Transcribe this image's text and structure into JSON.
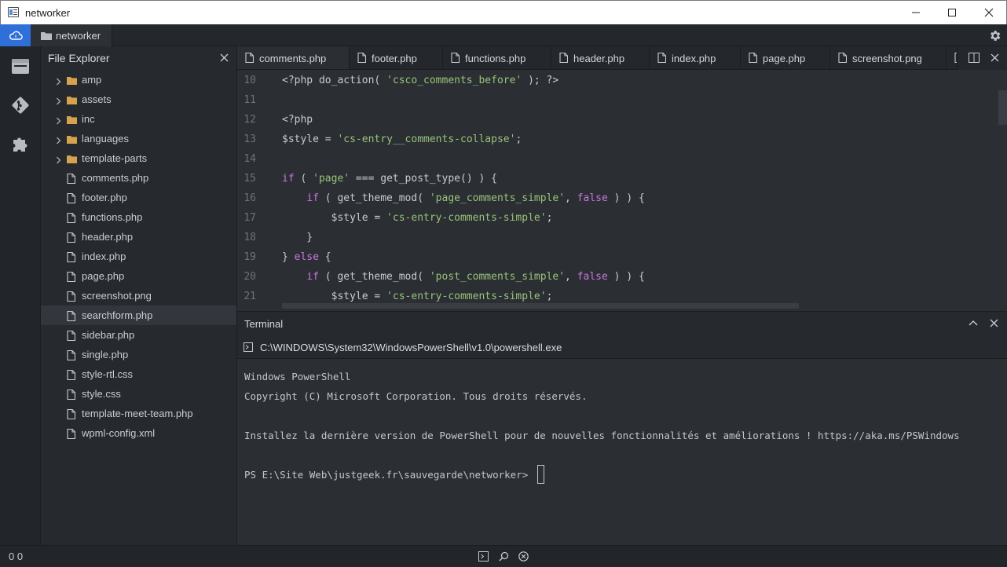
{
  "window": {
    "title": "networker"
  },
  "toolbar": {
    "project_label": "networker"
  },
  "explorer": {
    "title": "File Explorer",
    "folders": [
      "amp",
      "assets",
      "inc",
      "languages",
      "template-parts"
    ],
    "files": [
      "comments.php",
      "footer.php",
      "functions.php",
      "header.php",
      "index.php",
      "page.php",
      "screenshot.png",
      "searchform.php",
      "sidebar.php",
      "single.php",
      "style-rtl.css",
      "style.css",
      "template-meet-team.php",
      "wpml-config.xml"
    ],
    "selected": "searchform.php"
  },
  "tabs": [
    "comments.php",
    "footer.php",
    "functions.php",
    "header.php",
    "index.php",
    "page.php",
    "screenshot.png"
  ],
  "active_tab": "comments.php",
  "code": {
    "line_numbers": [
      "10",
      "11",
      "12",
      "13",
      "14",
      "15",
      "16",
      "17",
      "18",
      "19",
      "20",
      "21"
    ],
    "lines": [
      [
        {
          "t": "<?php do_action( ",
          "c": "p"
        },
        {
          "t": "'csco_comments_before'",
          "c": "s"
        },
        {
          "t": " ); ?>",
          "c": "p"
        }
      ],
      [],
      [
        {
          "t": "<?php",
          "c": "p"
        }
      ],
      [
        {
          "t": "$style = ",
          "c": "p"
        },
        {
          "t": "'cs-entry__comments-collapse'",
          "c": "s"
        },
        {
          "t": ";",
          "c": "p"
        }
      ],
      [],
      [
        {
          "t": "if",
          "c": "k"
        },
        {
          "t": " ( ",
          "c": "p"
        },
        {
          "t": "'page'",
          "c": "s"
        },
        {
          "t": " === get_post_type() ) {",
          "c": "p"
        }
      ],
      [
        {
          "t": "    ",
          "c": "p"
        },
        {
          "t": "if",
          "c": "k"
        },
        {
          "t": " ( get_theme_mod( ",
          "c": "p"
        },
        {
          "t": "'page_comments_simple'",
          "c": "s"
        },
        {
          "t": ", ",
          "c": "p"
        },
        {
          "t": "false",
          "c": "k"
        },
        {
          "t": " ) ) {",
          "c": "p"
        }
      ],
      [
        {
          "t": "        $style = ",
          "c": "p"
        },
        {
          "t": "'cs-entry-comments-simple'",
          "c": "s"
        },
        {
          "t": ";",
          "c": "p"
        }
      ],
      [
        {
          "t": "    }",
          "c": "p"
        }
      ],
      [
        {
          "t": "} ",
          "c": "p"
        },
        {
          "t": "else",
          "c": "k"
        },
        {
          "t": " {",
          "c": "p"
        }
      ],
      [
        {
          "t": "    ",
          "c": "p"
        },
        {
          "t": "if",
          "c": "k"
        },
        {
          "t": " ( get_theme_mod( ",
          "c": "p"
        },
        {
          "t": "'post_comments_simple'",
          "c": "s"
        },
        {
          "t": ", ",
          "c": "p"
        },
        {
          "t": "false",
          "c": "k"
        },
        {
          "t": " ) ) {",
          "c": "p"
        }
      ],
      [
        {
          "t": "        $style = ",
          "c": "p"
        },
        {
          "t": "'cs-entry-comments-simple'",
          "c": "s"
        },
        {
          "t": ";",
          "c": "p"
        }
      ]
    ]
  },
  "terminal": {
    "title": "Terminal",
    "shell_path": "C:\\WINDOWS\\System32\\WindowsPowerShell\\v1.0\\powershell.exe",
    "output": [
      "Windows PowerShell",
      "Copyright (C) Microsoft Corporation. Tous droits réservés.",
      "",
      "Installez la dernière version de PowerShell pour de nouvelles fonctionnalités et améliorations ! https://aka.ms/PSWindows",
      "",
      "PS E:\\Site Web\\justgeek.fr\\sauvegarde\\networker> "
    ]
  },
  "status": {
    "counts": "0 0"
  },
  "colors": {
    "accent": "#2f6fd9",
    "string": "#98c379",
    "keyword": "#c678dd",
    "background": "#2b2e33"
  },
  "icons": [
    "cloud-icon",
    "folder-icon",
    "gear-icon",
    "files-icon",
    "git-icon",
    "puzzle-icon",
    "split-editor-icon",
    "terminal-icon",
    "search-icon",
    "close-circle-icon"
  ]
}
